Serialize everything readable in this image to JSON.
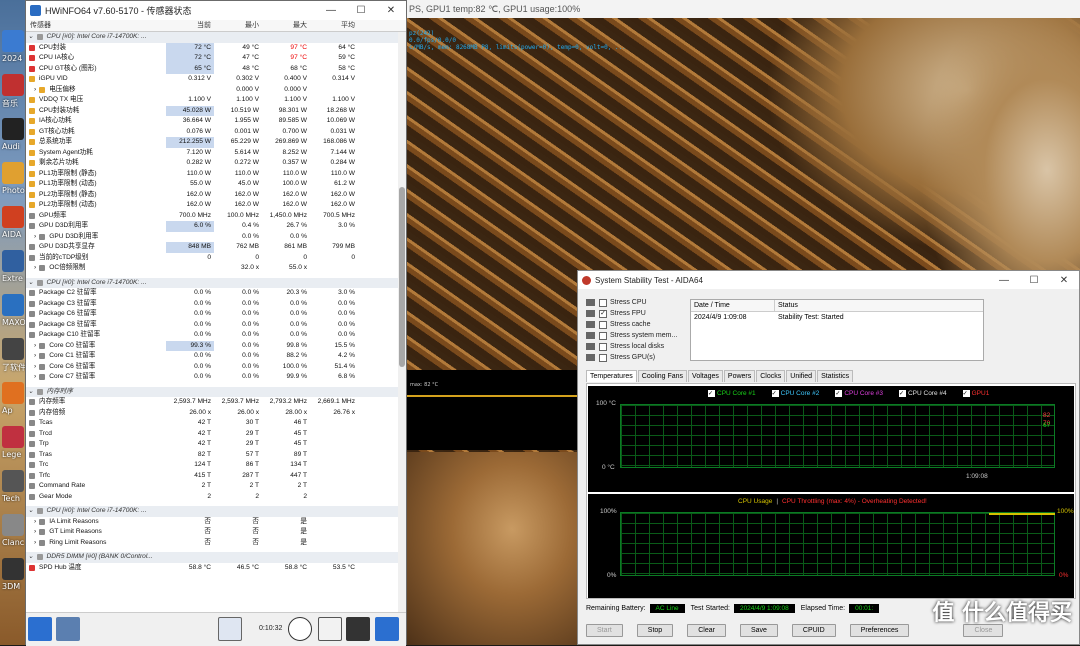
{
  "desktop": {
    "icons": [
      "2024",
      "音乐",
      "Audi",
      "Photo",
      "AIDA",
      "Extre",
      "MAXO",
      "了软件",
      "Ap",
      "Lege",
      "Tech",
      "Clanc",
      "3DM"
    ]
  },
  "render": {
    "title": "PS, GPU1 temp:82 ℃, GPU1 usage:100%",
    "overlay": [
      "pz(242)",
      "0.0/fps/0.0/0",
      "c/MB/s, mem: 8268MB P8, limits(power=0), temp=0, volt=0, ..."
    ],
    "graph_label": "max: 82 °C"
  },
  "hwinfo": {
    "title": "HWiNFO64 v7.60-5170 - 传感器状态",
    "columns": [
      "传感器",
      "当前",
      "最小",
      "最大",
      "平均"
    ],
    "rows": [
      {
        "t": "hdr",
        "n": "CPU [#0]: Intel Core i7-14700K: ..."
      },
      {
        "n": "CPU封装",
        "ic": "#d33",
        "v": [
          "72 °C",
          "49 °C",
          "97 °C",
          "64 °C"
        ],
        "hl": 0,
        "red": 2
      },
      {
        "n": "CPU IA核心",
        "ic": "#d33",
        "v": [
          "72 °C",
          "47 °C",
          "97 °C",
          "59 °C"
        ],
        "hl": 0,
        "red": 2
      },
      {
        "n": "CPU GT核心 (图形)",
        "ic": "#d33",
        "v": [
          "65 °C",
          "48 °C",
          "68 °C",
          "58 °C"
        ],
        "hl": 0
      },
      {
        "n": "iGPU VID",
        "ic": "#e7a82a",
        "v": [
          "0.312 V",
          "0.302 V",
          "0.400 V",
          "0.314 V"
        ]
      },
      {
        "n": "电压偏移",
        "ic": "#e7a82a",
        "v": [
          "",
          "0.000 V",
          "0.000 V",
          ""
        ],
        "indent": 1
      },
      {
        "n": "VDDQ TX 电压",
        "ic": "#e7a82a",
        "v": [
          "1.100 V",
          "1.100 V",
          "1.100 V",
          "1.100 V"
        ]
      },
      {
        "n": "CPU封装功耗",
        "ic": "#e7a82a",
        "v": [
          "45.028 W",
          "10.519 W",
          "98.301 W",
          "18.268 W"
        ],
        "hl": 0
      },
      {
        "n": "IA核心功耗",
        "ic": "#e7a82a",
        "v": [
          "36.664 W",
          "1.955 W",
          "89.585 W",
          "10.069 W"
        ]
      },
      {
        "n": "GT核心功耗",
        "ic": "#e7a82a",
        "v": [
          "0.076 W",
          "0.001 W",
          "0.700 W",
          "0.031 W"
        ]
      },
      {
        "n": "总系统功率",
        "ic": "#e7a82a",
        "v": [
          "212.255 W",
          "65.229 W",
          "269.869 W",
          "168.086 W"
        ],
        "hl": 0
      },
      {
        "n": "System Agent功耗",
        "ic": "#e7a82a",
        "v": [
          "7.120 W",
          "5.614 W",
          "8.252 W",
          "7.144 W"
        ]
      },
      {
        "n": "剩余芯片功耗",
        "ic": "#e7a82a",
        "v": [
          "0.282 W",
          "0.272 W",
          "0.357 W",
          "0.284 W"
        ]
      },
      {
        "n": "PL1功率限制 (静态)",
        "ic": "#e7a82a",
        "v": [
          "110.0 W",
          "110.0 W",
          "110.0 W",
          "110.0 W"
        ]
      },
      {
        "n": "PL1功率限制 (动态)",
        "ic": "#e7a82a",
        "v": [
          "55.0 W",
          "45.0 W",
          "100.0 W",
          "61.2 W"
        ]
      },
      {
        "n": "PL2功率限制 (静态)",
        "ic": "#e7a82a",
        "v": [
          "162.0 W",
          "162.0 W",
          "162.0 W",
          "162.0 W"
        ]
      },
      {
        "n": "PL2功率限制 (动态)",
        "ic": "#e7a82a",
        "v": [
          "162.0 W",
          "162.0 W",
          "162.0 W",
          "162.0 W"
        ]
      },
      {
        "n": "GPU频率",
        "ic": "#888",
        "v": [
          "700.0 MHz",
          "100.0 MHz",
          "1,450.0 MHz",
          "700.5 MHz"
        ]
      },
      {
        "n": "GPU D3D利用率",
        "ic": "#888",
        "v": [
          "6.0 %",
          "0.4 %",
          "26.7 %",
          "3.0 %"
        ],
        "hl": 0
      },
      {
        "n": "GPU D3D利用率",
        "ic": "#888",
        "v": [
          "",
          "0.0 %",
          "0.0 %",
          ""
        ],
        "indent": 1
      },
      {
        "n": "GPU D3D共享显存",
        "ic": "#888",
        "v": [
          "848 MB",
          "762 MB",
          "861 MB",
          "799 MB"
        ],
        "hl": 0
      },
      {
        "n": "当前的cTDP级别",
        "ic": "#888",
        "v": [
          "0",
          "0",
          "0",
          "0"
        ]
      },
      {
        "n": "OC倍频限制",
        "ic": "#888",
        "v": [
          "",
          "32.0 x",
          "55.0 x",
          ""
        ],
        "indent": 1
      },
      {
        "t": "sp"
      },
      {
        "t": "hdr",
        "n": "CPU [#0]: Intel Core i7-14700K: ..."
      },
      {
        "n": "Package C2 驻留率",
        "ic": "#888",
        "v": [
          "0.0 %",
          "0.0 %",
          "20.3 %",
          "3.0 %"
        ]
      },
      {
        "n": "Package C3 驻留率",
        "ic": "#888",
        "v": [
          "0.0 %",
          "0.0 %",
          "0.0 %",
          "0.0 %"
        ]
      },
      {
        "n": "Package C6 驻留率",
        "ic": "#888",
        "v": [
          "0.0 %",
          "0.0 %",
          "0.0 %",
          "0.0 %"
        ]
      },
      {
        "n": "Package C8 驻留率",
        "ic": "#888",
        "v": [
          "0.0 %",
          "0.0 %",
          "0.0 %",
          "0.0 %"
        ]
      },
      {
        "n": "Package C10 驻留率",
        "ic": "#888",
        "v": [
          "0.0 %",
          "0.0 %",
          "0.0 %",
          "0.0 %"
        ]
      },
      {
        "n": "Core C0 驻留率",
        "ic": "#888",
        "v": [
          "99.3 %",
          "0.0 %",
          "99.8 %",
          "15.5 %"
        ],
        "hl": 0,
        "indent": 1
      },
      {
        "n": "Core C1 驻留率",
        "ic": "#888",
        "v": [
          "0.0 %",
          "0.0 %",
          "88.2 %",
          "4.2 %"
        ],
        "indent": 1
      },
      {
        "n": "Core C6 驻留率",
        "ic": "#888",
        "v": [
          "0.0 %",
          "0.0 %",
          "100.0 %",
          "51.4 %"
        ],
        "indent": 1
      },
      {
        "n": "Core C7 驻留率",
        "ic": "#888",
        "v": [
          "0.0 %",
          "0.0 %",
          "99.9 %",
          "6.8 %"
        ],
        "indent": 1
      },
      {
        "t": "sp"
      },
      {
        "t": "hdr",
        "n": "内存时序"
      },
      {
        "n": "内存频率",
        "ic": "#888",
        "v": [
          "2,593.7 MHz",
          "2,593.7 MHz",
          "2,793.2 MHz",
          "2,669.1 MHz"
        ]
      },
      {
        "n": "内存倍频",
        "ic": "#888",
        "v": [
          "26.00 x",
          "26.00 x",
          "28.00 x",
          "26.76 x"
        ]
      },
      {
        "n": "Tcas",
        "ic": "#888",
        "v": [
          "42 T",
          "30 T",
          "46 T",
          ""
        ]
      },
      {
        "n": "Trcd",
        "ic": "#888",
        "v": [
          "42 T",
          "29 T",
          "45 T",
          ""
        ]
      },
      {
        "n": "Trp",
        "ic": "#888",
        "v": [
          "42 T",
          "29 T",
          "45 T",
          ""
        ]
      },
      {
        "n": "Tras",
        "ic": "#888",
        "v": [
          "82 T",
          "57 T",
          "89 T",
          ""
        ]
      },
      {
        "n": "Trc",
        "ic": "#888",
        "v": [
          "124 T",
          "86 T",
          "134 T",
          ""
        ]
      },
      {
        "n": "Trfc",
        "ic": "#888",
        "v": [
          "415 T",
          "287 T",
          "447 T",
          ""
        ]
      },
      {
        "n": "Command Rate",
        "ic": "#888",
        "v": [
          "2 T",
          "2 T",
          "2 T",
          ""
        ]
      },
      {
        "n": "Gear Mode",
        "ic": "#888",
        "v": [
          "2",
          "2",
          "2",
          ""
        ]
      },
      {
        "t": "sp"
      },
      {
        "t": "hdr",
        "n": "CPU [#0]: Intel Core i7-14700K: ..."
      },
      {
        "n": "IA Limit Reasons",
        "ic": "#888",
        "v": [
          "否",
          "否",
          "是",
          ""
        ],
        "indent": 1
      },
      {
        "n": "GT Limit Reasons",
        "ic": "#888",
        "v": [
          "否",
          "否",
          "是",
          ""
        ],
        "indent": 1
      },
      {
        "n": "Ring Limit Reasons",
        "ic": "#888",
        "v": [
          "否",
          "否",
          "是",
          ""
        ],
        "indent": 1
      },
      {
        "t": "sp"
      },
      {
        "t": "hdr",
        "n": "DDR5 DIMM [#0] (BANK 0/Control..."
      },
      {
        "n": "SPD Hub 温度",
        "ic": "#d33",
        "v": [
          "58.8 °C",
          "46.5 °C",
          "58.8 °C",
          "53.5 °C"
        ]
      }
    ],
    "timer": "0:10:32"
  },
  "aida": {
    "title": "System Stability Test - AIDA64",
    "stress": [
      {
        "l": "Stress CPU",
        "c": false
      },
      {
        "l": "Stress FPU",
        "c": true
      },
      {
        "l": "Stress cache",
        "c": false
      },
      {
        "l": "Stress system mem...",
        "c": false
      },
      {
        "l": "Stress local disks",
        "c": false
      },
      {
        "l": "Stress GPU(s)",
        "c": false
      }
    ],
    "status_cols": [
      "Date / Time",
      "Status"
    ],
    "status_row": [
      "2024/4/9 1:09:08",
      "Stability Test: Started"
    ],
    "tabs": [
      "Temperatures",
      "Cooling Fans",
      "Voltages",
      "Powers",
      "Clocks",
      "Unified",
      "Statistics"
    ],
    "legend": [
      {
        "l": "CPU Core #1",
        "c": "#19d319"
      },
      {
        "l": "CPU Core #2",
        "c": "#3fc9ff"
      },
      {
        "l": "CPU Core #3",
        "c": "#e040e0"
      },
      {
        "l": "CPU Core #4",
        "c": "#e0e0e0"
      },
      {
        "l": "GPU1",
        "c": "#ff3030"
      }
    ],
    "g1": {
      "ymax": "100 °C",
      "ymin": "0 °C",
      "xlab": "1:09:08",
      "vals": [
        "82",
        "70",
        "67"
      ]
    },
    "g2": {
      "title_a": "CPU Usage",
      "sep": "|",
      "title_b": "CPU Throttling (max: 4%) - Overheating Detected!",
      "ymax": "100%",
      "ymin": "0%",
      "rmax": "100%",
      "rmin": "0%"
    },
    "bottom": {
      "battery_label": "Remaining Battery:",
      "battery": "AC Line",
      "started_label": "Test Started:",
      "started": "2024/4/9 1:09:08",
      "elapsed_label": "Elapsed Time:",
      "elapsed": "00:01:"
    },
    "buttons": [
      "Start",
      "Stop",
      "Clear",
      "Save",
      "CPUID",
      "Preferences",
      "Close"
    ]
  },
  "watermark": "值 什么值得买"
}
